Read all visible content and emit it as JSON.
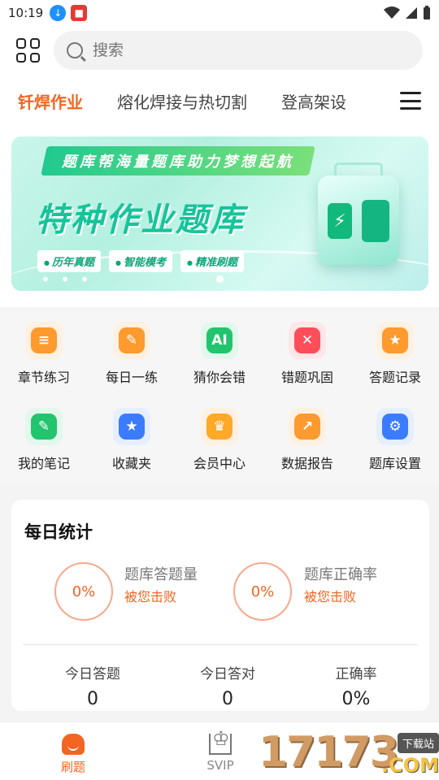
{
  "status_bar": {
    "time": "10:19"
  },
  "search": {
    "placeholder": "搜索"
  },
  "tabs": [
    {
      "label": "钎焊作业",
      "active": true
    },
    {
      "label": "熔化焊接与热切割",
      "active": false
    },
    {
      "label": "登高架设",
      "active": false
    }
  ],
  "banner": {
    "ribbon": "题库帮海量题库助力梦想起航",
    "title": "特种作业题库",
    "tags": [
      "历年真题",
      "智能模考",
      "精准刷题"
    ]
  },
  "features": [
    {
      "label": "章节练习",
      "icon": "chapter-icon",
      "bg": "#fff1e2",
      "color": "#ff9a2e",
      "glyph": "≡"
    },
    {
      "label": "每日一练",
      "icon": "daily-icon",
      "bg": "#fff1e2",
      "color": "#ff9a2e",
      "glyph": "✎"
    },
    {
      "label": "猜你会错",
      "icon": "ai-icon",
      "bg": "#e3f8ec",
      "color": "#22c46e",
      "glyph": "AI"
    },
    {
      "label": "错题巩固",
      "icon": "wrong-icon",
      "bg": "#ffe6e8",
      "color": "#ff4d5a",
      "glyph": "✕"
    },
    {
      "label": "答题记录",
      "icon": "record-icon",
      "bg": "#fff1e2",
      "color": "#ff9a2e",
      "glyph": "★"
    },
    {
      "label": "我的笔记",
      "icon": "note-icon",
      "bg": "#e3f8ec",
      "color": "#22c46e",
      "glyph": "✎"
    },
    {
      "label": "收藏夹",
      "icon": "favorite-icon",
      "bg": "#e6efff",
      "color": "#3b7bff",
      "glyph": "★"
    },
    {
      "label": "会员中心",
      "icon": "vip-icon",
      "bg": "#fff1e2",
      "color": "#ffa928",
      "glyph": "♛"
    },
    {
      "label": "数据报告",
      "icon": "report-icon",
      "bg": "#fff1e2",
      "color": "#ff9a2e",
      "glyph": "↗"
    },
    {
      "label": "题库设置",
      "icon": "settings-icon",
      "bg": "#e6efff",
      "color": "#3b7bff",
      "glyph": "⚙"
    }
  ],
  "daily_stats": {
    "title": "每日统计",
    "circle1": {
      "value": "0%",
      "name": "题库答题量",
      "sub": "被您击败"
    },
    "circle2": {
      "value": "0%",
      "name": "题库正确率",
      "sub": "被您击败"
    },
    "bottom": [
      {
        "label": "今日答题",
        "value": "0"
      },
      {
        "label": "今日答对",
        "value": "0"
      },
      {
        "label": "正确率",
        "value": "0%"
      }
    ]
  },
  "tabbar": [
    {
      "label": "刷题",
      "active": true
    },
    {
      "label": "SVIP",
      "active": false
    }
  ],
  "watermark": {
    "number": "17173",
    "badge": "下载站",
    "domain": ".COM"
  }
}
